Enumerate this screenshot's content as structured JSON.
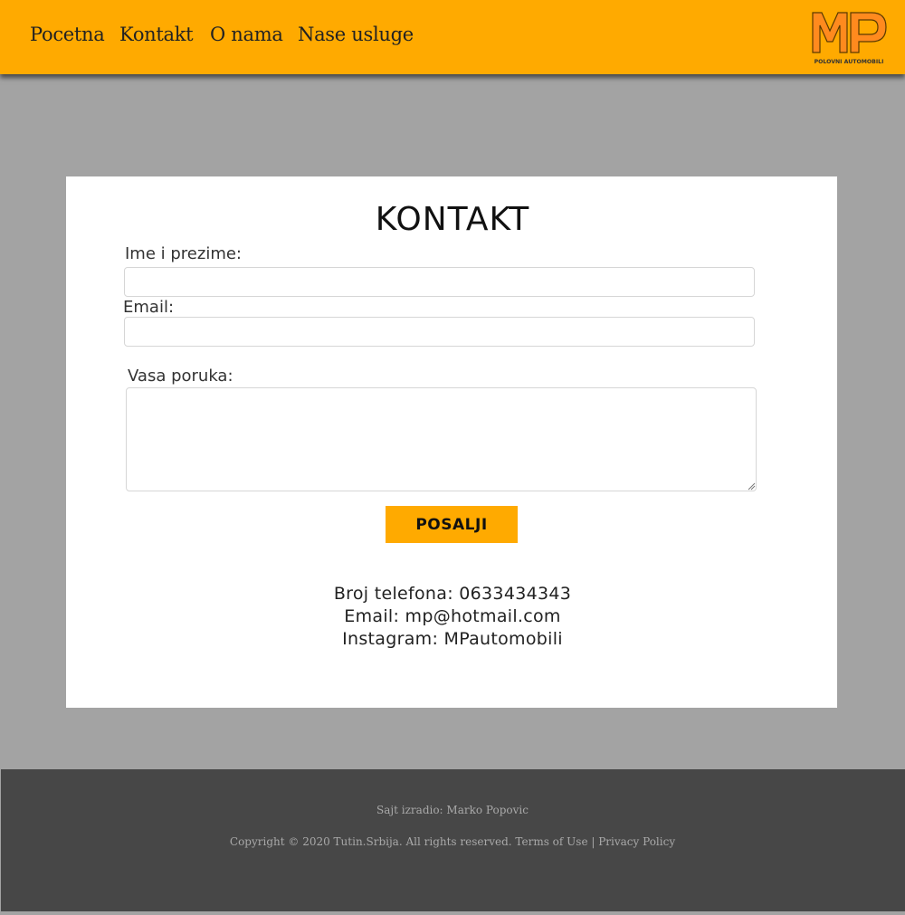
{
  "nav": {
    "items": [
      {
        "label": "Pocetna"
      },
      {
        "label": "Kontakt"
      },
      {
        "label": "O nama"
      },
      {
        "label": "Nase usluge"
      }
    ]
  },
  "logo": {
    "letters": "MP",
    "tagline": "POLOVNI AUTOMOBILI",
    "accent": "#ffaa00"
  },
  "page": {
    "title": "KONTAKT"
  },
  "form": {
    "name_label": "Ime i prezime:",
    "name_value": "",
    "email_label": "Email:",
    "email_value": "",
    "message_label": "Vasa poruka:",
    "message_value": "",
    "submit_label": "POSALJI"
  },
  "contact": {
    "phone": "Broj telefona: 0633434343",
    "email": "Email: mp@hotmail.com",
    "instagram": "Instagram: MPautomobili"
  },
  "footer": {
    "author": "Sajt izradio: Marko Popovic",
    "copyright": "Copyright © 2020 Tutin.Srbija. All rights reserved. Terms of Use | Privacy Policy"
  },
  "colors": {
    "brand": "#ffaa00",
    "page_bg": "#a3a3a3",
    "footer_bg": "#474747"
  }
}
